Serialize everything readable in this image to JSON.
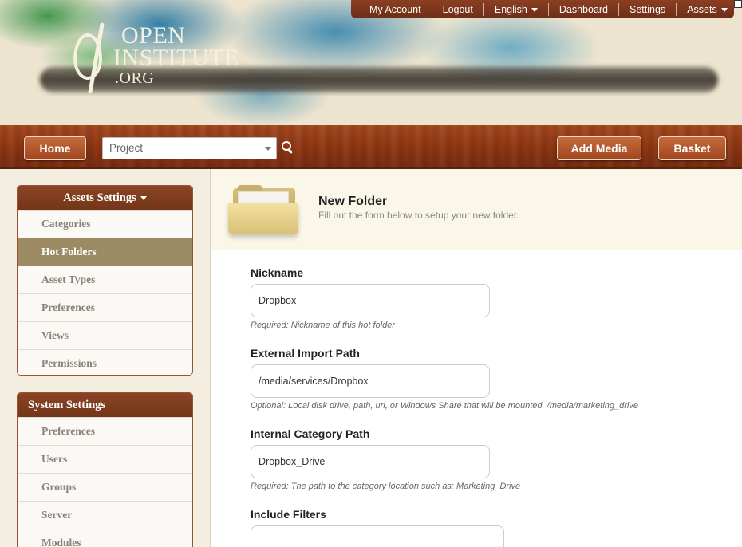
{
  "brand": {
    "logo_line1": "OPEN",
    "logo_line2": "INSTITUTE",
    "logo_line3": ".ORG"
  },
  "top_menu": {
    "items": [
      {
        "label": "My Account",
        "has_caret": false
      },
      {
        "label": "Logout",
        "has_caret": false
      },
      {
        "label": "English",
        "has_caret": true
      },
      {
        "label": "Dashboard",
        "has_caret": false,
        "active": true
      },
      {
        "label": "Settings",
        "has_caret": false
      },
      {
        "label": "Assets",
        "has_caret": true
      }
    ]
  },
  "navbar": {
    "home_label": "Home",
    "project_placeholder": "Project",
    "add_media_label": "Add Media",
    "basket_label": "Basket"
  },
  "sidebar": {
    "assets_settings": {
      "title": "Assets Settings",
      "items": [
        {
          "label": "Categories",
          "active": false
        },
        {
          "label": "Hot Folders",
          "active": true
        },
        {
          "label": "Asset Types",
          "active": false
        },
        {
          "label": "Preferences",
          "active": false
        },
        {
          "label": "Views",
          "active": false
        },
        {
          "label": "Permissions",
          "active": false
        }
      ]
    },
    "system_settings": {
      "title": "System Settings",
      "items": [
        {
          "label": "Preferences"
        },
        {
          "label": "Users"
        },
        {
          "label": "Groups"
        },
        {
          "label": "Server"
        },
        {
          "label": "Modules"
        }
      ]
    }
  },
  "form": {
    "title": "New Folder",
    "subtitle": "Fill out the form below to setup your new folder.",
    "fields": [
      {
        "label": "Nickname",
        "value": "Dropbox",
        "help": "Required: Nickname of this hot folder"
      },
      {
        "label": "External Import Path",
        "value": "/media/services/Dropbox",
        "help": "Optional: Local disk drive, path, url, or Windows Share that will be mounted. /media/marketing_drive"
      },
      {
        "label": "Internal Category Path",
        "value": "Dropbox_Drive",
        "help": "Required: The path to the category location such as: Marketing_Drive"
      },
      {
        "label": "Include Filters",
        "value": "",
        "help": ""
      }
    ]
  },
  "colors": {
    "wood": "#8c3412",
    "panel_head": "#7d3b1e",
    "active_item": "#9b8a62"
  }
}
